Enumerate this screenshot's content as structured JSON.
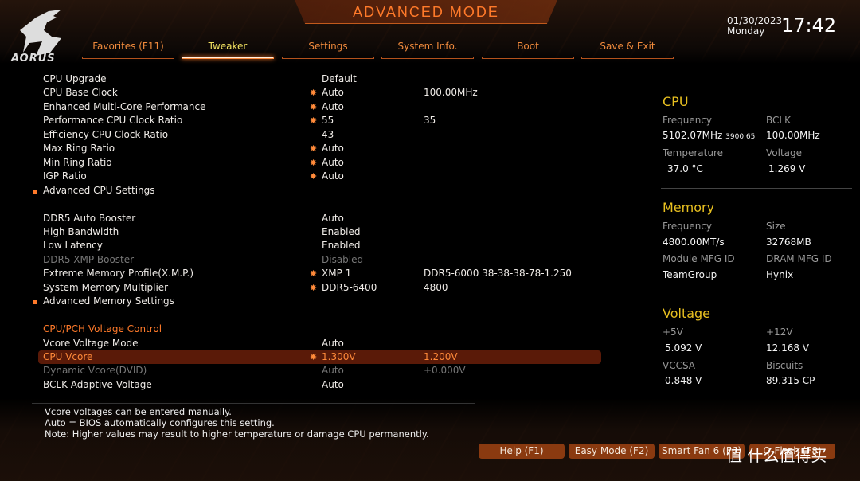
{
  "header": {
    "title": "ADVANCED MODE",
    "logo": "AORUS",
    "date": "01/30/2023",
    "day": "Monday",
    "time": "17:42"
  },
  "tabs": [
    {
      "label": "Favorites (F11)"
    },
    {
      "label": "Tweaker",
      "active": true
    },
    {
      "label": "Settings"
    },
    {
      "label": "System Info."
    },
    {
      "label": "Boot"
    },
    {
      "label": "Save & Exit"
    }
  ],
  "settings": [
    {
      "name": "CPU Upgrade",
      "value": "Default"
    },
    {
      "name": "CPU Base Clock",
      "star": true,
      "value": "Auto",
      "value2": "100.00MHz"
    },
    {
      "name": "Enhanced Multi-Core Performance",
      "star": true,
      "value": "Auto"
    },
    {
      "name": "Performance CPU Clock Ratio",
      "star": true,
      "value": "55",
      "value2": "35"
    },
    {
      "name": "Efficiency CPU Clock Ratio",
      "value": "43"
    },
    {
      "name": "Max Ring Ratio",
      "star": true,
      "value": "Auto"
    },
    {
      "name": "Min Ring Ratio",
      "star": true,
      "value": "Auto"
    },
    {
      "name": "IGP Ratio",
      "star": true,
      "value": "Auto"
    },
    {
      "name": "Advanced CPU Settings",
      "submenu": true
    },
    {
      "gap": true
    },
    {
      "name": "DDR5 Auto Booster",
      "value": "Auto"
    },
    {
      "name": "High Bandwidth",
      "value": "Enabled"
    },
    {
      "name": "Low Latency",
      "value": "Enabled"
    },
    {
      "name": "DDR5 XMP Booster",
      "value": "Disabled",
      "disabled": true
    },
    {
      "name": "Extreme Memory Profile(X.M.P.)",
      "star": true,
      "value": "XMP 1",
      "value2": "DDR5-6000 38-38-38-78-1.250"
    },
    {
      "name": "System Memory Multiplier",
      "star": true,
      "value": "DDR5-6400",
      "value2": "4800"
    },
    {
      "name": "Advanced Memory Settings",
      "submenu": true
    },
    {
      "gap": true
    },
    {
      "name": "CPU/PCH Voltage Control",
      "section": true
    },
    {
      "name": "Vcore Voltage Mode",
      "value": "Auto"
    },
    {
      "name": "CPU Vcore",
      "star": true,
      "value": "1.300V",
      "value2": "1.200V",
      "selected": true
    },
    {
      "name": "Dynamic Vcore(DVID)",
      "value": "Auto",
      "value2": "+0.000V",
      "disabled": true
    },
    {
      "name": "BCLK Adaptive Voltage",
      "value": "Auto"
    }
  ],
  "help": [
    "Vcore voltages can be entered manually.",
    "Auto = BIOS automatically configures this setting.",
    "Note: Higher values may result to higher temperature or damage CPU permanently."
  ],
  "panel": {
    "cpu": {
      "title": "CPU",
      "freq_label": "Frequency",
      "freq": "5102.07MHz",
      "freq_sub": "3900.65",
      "bclk_label": "BCLK",
      "bclk": "100.00MHz",
      "temp_label": "Temperature",
      "temp": "37.0 °C",
      "volt_label": "Voltage",
      "volt": "1.269 V"
    },
    "memory": {
      "title": "Memory",
      "freq_label": "Frequency",
      "freq": "4800.00MT/s",
      "size_label": "Size",
      "size": "32768MB",
      "mod_label": "Module MFG ID",
      "mod": "TeamGroup",
      "dram_label": "DRAM MFG ID",
      "dram": "Hynix"
    },
    "voltage": {
      "title": "Voltage",
      "p5_label": "+5V",
      "p5": "5.092 V",
      "p12_label": "+12V",
      "p12": "12.168 V",
      "vccsa_label": "VCCSA",
      "vccsa": "0.848 V",
      "bisc_label": "Biscuits",
      "bisc": "89.315 CP"
    }
  },
  "footer": {
    "buttons": [
      "Help (F1)",
      "Easy Mode (F2)",
      "Smart Fan 6 (F6)",
      "Q-Flash (F8)"
    ],
    "watermark": "值 什么值得买"
  },
  "colors": {
    "accent": "#ff7a2a",
    "panel_heading": "#e8c020",
    "selected_row": "#5a1a08"
  }
}
